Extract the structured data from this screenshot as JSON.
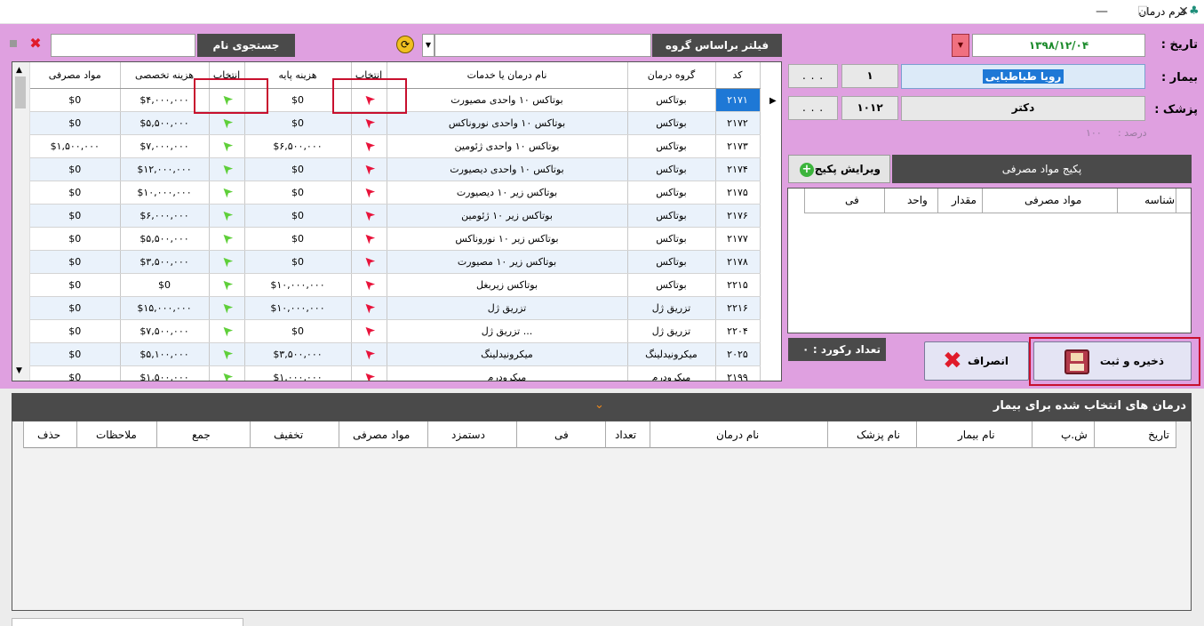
{
  "window": {
    "title": "فرم درمان",
    "minimize": "—",
    "maximize": "☐",
    "close": "✕"
  },
  "search": {
    "label": "جستجوی نام درمان :",
    "value": ""
  },
  "filter": {
    "label": "فیلتر براساس گروه درمان :",
    "value": ""
  },
  "form": {
    "date_label": "تاریخ :",
    "date_value": "۱۳۹۸/۱۲/۰۴",
    "patient_label": "بیمار :",
    "patient_name": "رویا طباطبایی",
    "patient_id": "۱",
    "doctor_label": "پزشک :",
    "doctor_name": "دکتر",
    "doctor_id": "۱۰۱۲",
    "percent_label": "درصد :",
    "percent_value": "۱۰۰",
    "ellipsis": ". . ."
  },
  "grid": {
    "columns": [
      "کد",
      "گروه درمان",
      "نام درمان یا خدمات",
      "انتخاب",
      "هزینه پایه",
      "انتخاب",
      "هزینه تخصصی",
      "مواد مصرفی"
    ],
    "rows": [
      {
        "code": "۲۱۷۱",
        "group": "بوتاکس",
        "name": "بوتاکس ۱۰ واحدی مصیورت",
        "base": "$0",
        "special": "$۴,۰۰۰,۰۰۰",
        "material": "$0"
      },
      {
        "code": "۲۱۷۲",
        "group": "بوتاکس",
        "name": "بوتاکس ۱۰ واحدی نوروناکس",
        "base": "$0",
        "special": "$۵,۵۰۰,۰۰۰",
        "material": "$0"
      },
      {
        "code": "۲۱۷۳",
        "group": "بوتاکس",
        "name": "بوتاکس ۱۰ واحدی ژئومین",
        "base": "$۶,۵۰۰,۰۰۰",
        "special": "$۷,۰۰۰,۰۰۰",
        "material": "$۱,۵۰۰,۰۰۰"
      },
      {
        "code": "۲۱۷۴",
        "group": "بوتاکس",
        "name": "بوتاکس ۱۰ واحدی دیصیورت",
        "base": "$0",
        "special": "$۱۲,۰۰۰,۰۰۰",
        "material": "$0"
      },
      {
        "code": "۲۱۷۵",
        "group": "بوتاکس",
        "name": "بوتاکس زیر ۱۰ دیصیورت",
        "base": "$0",
        "special": "$۱۰,۰۰۰,۰۰۰",
        "material": "$0"
      },
      {
        "code": "۲۱۷۶",
        "group": "بوتاکس",
        "name": "بوتاکس زیر ۱۰ ژئومین",
        "base": "$0",
        "special": "$۶,۰۰۰,۰۰۰",
        "material": "$0"
      },
      {
        "code": "۲۱۷۷",
        "group": "بوتاکس",
        "name": "بوتاکس زیر ۱۰ نوروناکس",
        "base": "$0",
        "special": "$۵,۵۰۰,۰۰۰",
        "material": "$0"
      },
      {
        "code": "۲۱۷۸",
        "group": "بوتاکس",
        "name": "بوتاکس زیر ۱۰ مصیورت",
        "base": "$0",
        "special": "$۳,۵۰۰,۰۰۰",
        "material": "$0"
      },
      {
        "code": "۲۲۱۵",
        "group": "بوتاکس",
        "name": "بوتاکس زیربغل",
        "base": "$۱۰,۰۰۰,۰۰۰",
        "special": "$0",
        "material": "$0"
      },
      {
        "code": "۲۲۱۶",
        "group": "تزریق ژل",
        "name": "تزریق ژل",
        "base": "$۱۰,۰۰۰,۰۰۰",
        "special": "$۱۵,۰۰۰,۰۰۰",
        "material": "$0"
      },
      {
        "code": "۲۲۰۴",
        "group": "تزریق ژل",
        "name": "تزریق ژل ...",
        "base": "$0",
        "special": "$۷,۵۰۰,۰۰۰",
        "material": "$0"
      },
      {
        "code": "۲۰۲۵",
        "group": "میکرونیدلینگ",
        "name": "میکرونیدلینگ",
        "base": "$۳,۵۰۰,۰۰۰",
        "special": "$۵,۱۰۰,۰۰۰",
        "material": "$0"
      },
      {
        "code": "۲۱۹۹",
        "group": "میکرودرم",
        "name": "میکرودرم",
        "base": "$۱,۰۰۰,۰۰۰",
        "special": "$۱,۵۰۰,۰۰۰",
        "material": "$0"
      }
    ]
  },
  "package": {
    "title": "پکیج مواد مصرفی",
    "edit_label": "ویرایش پکیج",
    "columns": [
      "شناسه",
      "مواد مصرفی",
      "مقدار",
      "واحد",
      "فی"
    ]
  },
  "records": {
    "label": "تعداد رکورد :",
    "value": "۰"
  },
  "actions": {
    "save_label": "ذخیره و ثبت",
    "cancel_label": "انصراف"
  },
  "selected": {
    "title": "درمان های انتخاب شده برای بیمار",
    "columns": [
      "تاریخ",
      "ش.پ",
      "نام بیمار",
      "نام پزشک",
      "نام درمان",
      "تعداد",
      "فی",
      "دستمزد",
      "مواد مصرفی",
      "تخفیف",
      "جمع",
      "ملاحظات",
      "حذف"
    ]
  },
  "colors": {
    "panel": "#dfa0e0",
    "dark": "#4a4a4a",
    "selection": "#1e78d6",
    "highlight_box": "#c8102e",
    "date_text": "#1a8a2a"
  }
}
